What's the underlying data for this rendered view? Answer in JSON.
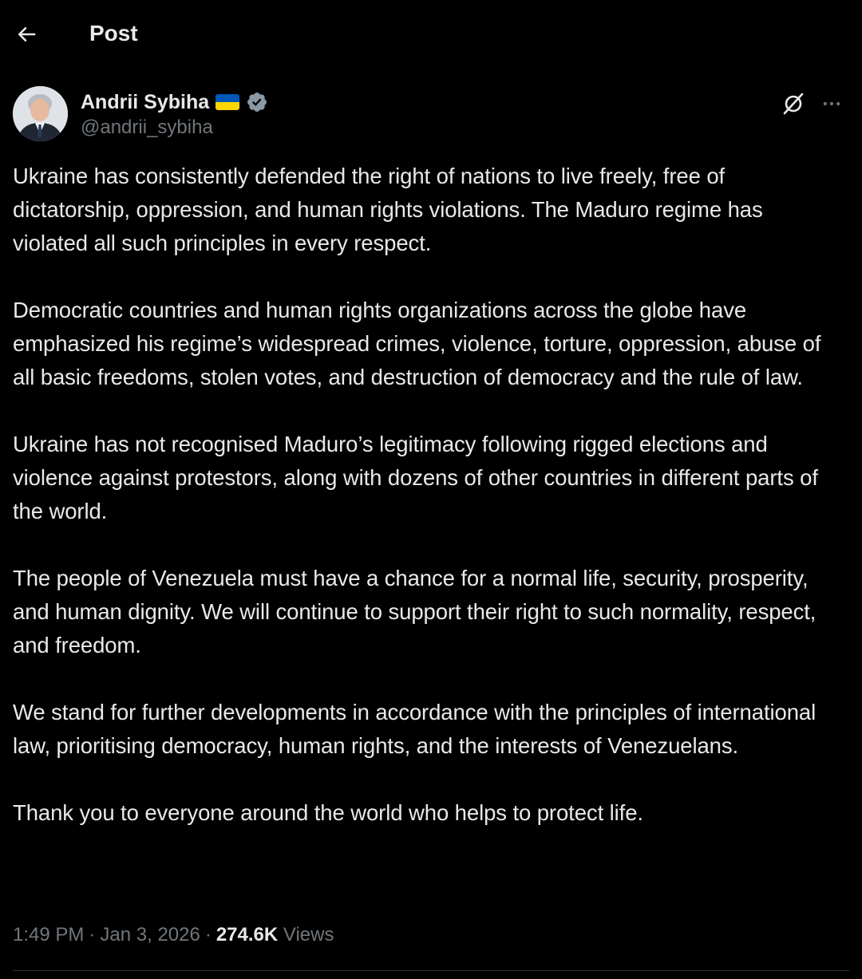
{
  "header": {
    "title": "Post",
    "back_icon": "arrow-left-icon"
  },
  "author": {
    "name": "Andrii Sybiha",
    "handle": "@andrii_sybiha",
    "flag_icon": "ukraine-flag-icon",
    "verified_icon": "verified-badge-icon",
    "verified_color": "#8b98a5"
  },
  "actions": {
    "grok_icon": "grok-icon",
    "more_icon": "more-horizontal-icon"
  },
  "post": {
    "paragraphs": [
      "Ukraine has consistently defended the right of nations to live freely, free of dictatorship, oppression, and human rights violations. The Maduro regime has violated all such principles in every respect.",
      "Democratic countries and human rights organizations across the globe have emphasized his regime’s widespread crimes, violence, torture, oppression, abuse of all basic freedoms, stolen votes, and destruction of democracy and the rule of law.",
      "Ukraine has not recognised Maduro’s legitimacy following rigged elections and violence against protestors, along with dozens of other countries in different parts of the world.",
      "The people of Venezuela must have a chance for a normal life, security, prosperity, and human dignity. We will continue to support their right to such normality, respect, and freedom.",
      "We stand for further developments in accordance with the principles of international law, prioritising democracy, human rights, and the interests of Venezuelans.",
      "Thank you to everyone around the world who helps to protect life."
    ]
  },
  "meta": {
    "time": "1:49 PM",
    "separator": "·",
    "date": "Jan 3, 2026",
    "views_count": "274.6K",
    "views_label": "Views"
  },
  "colors": {
    "background": "#000000",
    "text": "#e7e9ea",
    "secondary_text": "#71767b",
    "divider": "#2f3336",
    "flag_blue": "#0057b7",
    "flag_yellow": "#ffd700"
  }
}
